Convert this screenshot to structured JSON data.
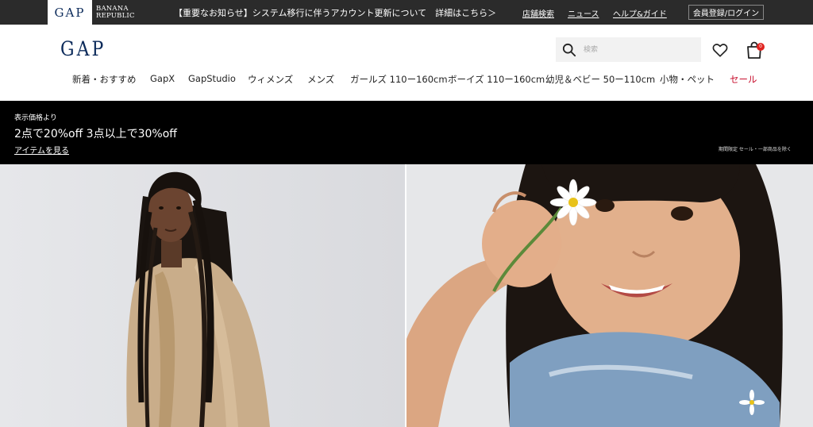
{
  "topbar": {
    "brands": {
      "gap": "GAP",
      "banana_republic_line1": "BANANA",
      "banana_republic_line2": "REPUBLIC"
    },
    "notice": "【重要なお知らせ】システム移行に伴うアカウント更新について　詳細はこちら＞",
    "links": {
      "store_search": "店舗検索",
      "news": "ニュース",
      "help": "ヘルプ&ガイド"
    },
    "register_login": "会員登録/ログイン"
  },
  "header": {
    "logo": "GAP",
    "search": {
      "placeholder": "検索",
      "icon": "search-icon"
    },
    "wishlist_icon": "heart-icon",
    "bag": {
      "icon": "bag-icon",
      "count": "0",
      "badge_color": "#e0231f"
    }
  },
  "nav": {
    "items": [
      {
        "label": "新着・おすすめ"
      },
      {
        "label": "GapX"
      },
      {
        "label": "GapStudio"
      },
      {
        "label": "ウィメンズ"
      },
      {
        "label": "メンズ"
      },
      {
        "label": "ガールズ 110ー160cm"
      },
      {
        "label": "ボーイズ 110ー160cm"
      },
      {
        "label": "幼児＆ベビー 50ー110cm"
      },
      {
        "label": "小物・ペット"
      },
      {
        "label": "セール",
        "color": "#c8102e"
      }
    ]
  },
  "promo": {
    "eyebrow": "表示価格より",
    "headline": "2点で20%off 3点以上で30%off",
    "cta": "アイテムを見る",
    "note": "期間限定 セール・一部商品を除く"
  },
  "colors": {
    "topbar_bg": "#2b2b2b",
    "promo_bg": "#000000",
    "sale": "#c8102e",
    "logo": "#0b2a5a"
  }
}
